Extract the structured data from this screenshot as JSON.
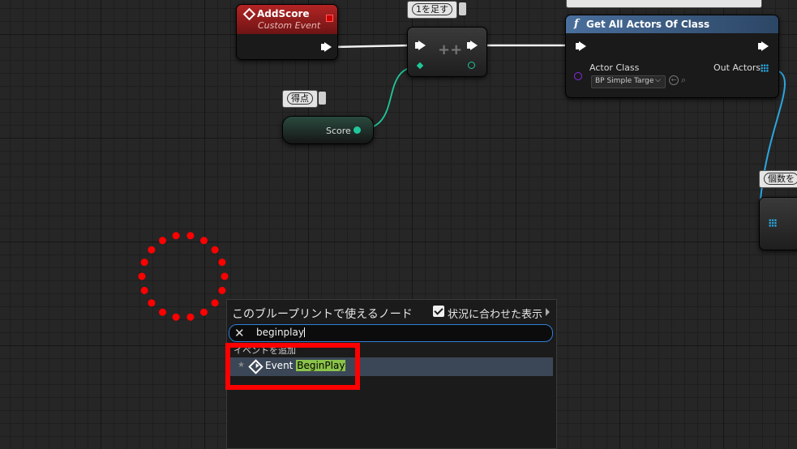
{
  "nodes": {
    "add_score": {
      "title": "AddScore",
      "subtitle": "Custom Event"
    },
    "increment": {
      "comment": "1を足す",
      "symbol": "++"
    },
    "score_var": {
      "comment": "得点",
      "pin_label": "Score"
    },
    "get_all_actors": {
      "title": "Get All Actors Of Class",
      "actor_class_label": "Actor Class",
      "actor_class_value": "BP Simple Targe",
      "out_label": "Out Actors"
    },
    "count": {
      "comment": "個数を"
    }
  },
  "menu": {
    "title": "このブループリントで使えるノード",
    "context_label": "状況に合わせた表示",
    "context_checked": true,
    "search_value": "beginplay",
    "category": "イベントを追加",
    "result_prefix": "Event",
    "result_highlight": "BeginPlay"
  },
  "colors": {
    "event_header": "#8b1a1a",
    "function_header": "#3d5f87",
    "highlight_box": "#ff0000",
    "search_border": "#2f7fd8"
  }
}
